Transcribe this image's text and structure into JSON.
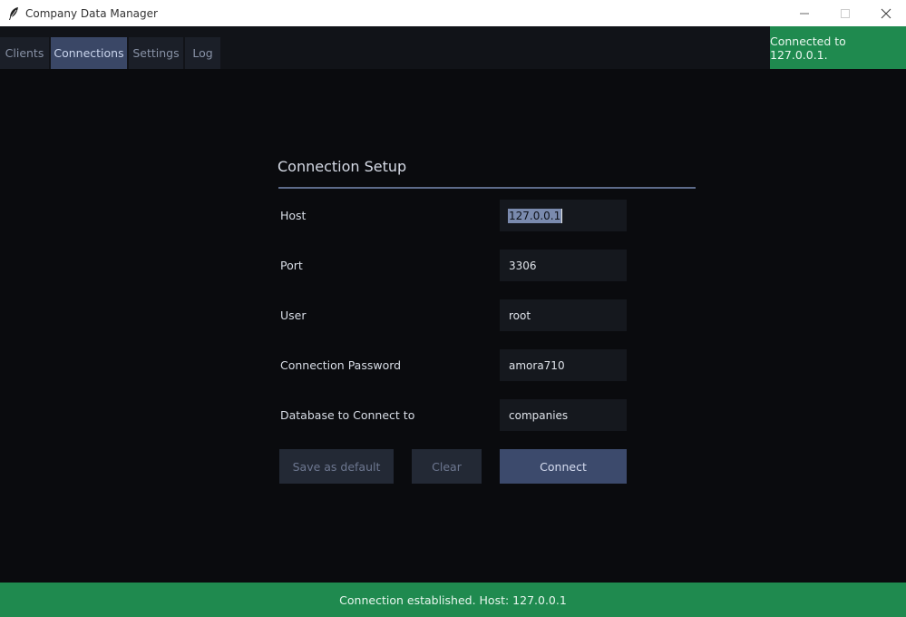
{
  "window": {
    "title": "Company Data Manager",
    "icon": "feather-icon"
  },
  "tabs": [
    {
      "label": "Clients",
      "active": false
    },
    {
      "label": "Connections",
      "active": true
    },
    {
      "label": "Settings",
      "active": false
    },
    {
      "label": "Log",
      "active": false
    }
  ],
  "header_status": "Connected to 127.0.0.1.",
  "form": {
    "title": "Connection Setup",
    "fields": {
      "host": {
        "label": "Host",
        "value": "127.0.0.1"
      },
      "port": {
        "label": "Port",
        "value": "3306"
      },
      "user": {
        "label": "User",
        "value": "root"
      },
      "password": {
        "label": "Connection Password",
        "value": "amora710"
      },
      "database": {
        "label": "Database to Connect to",
        "value": "companies"
      }
    },
    "buttons": {
      "save_default": "Save as default",
      "clear": "Clear",
      "connect": "Connect"
    }
  },
  "status_bar": "Connection established. Host: 127.0.0.1",
  "colors": {
    "background": "#0a0b0e",
    "accent_green": "#1f8a4f",
    "active_tab": "#3a4766",
    "connect_button": "#3c4a6c"
  }
}
